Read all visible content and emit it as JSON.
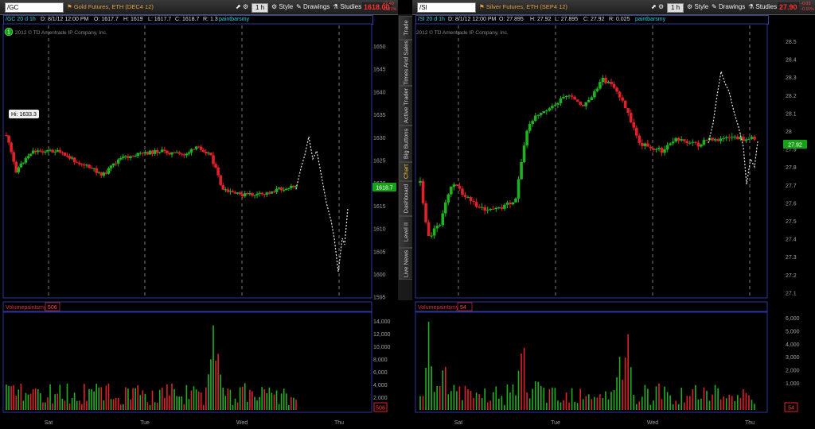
{
  "left": {
    "symbol": "/GC",
    "title": "Gold Futures, ETH (DEC4 12)",
    "timeframe": "1 h",
    "style_label": "Style",
    "drawings_label": "Drawings",
    "studies_label": "Studies",
    "last_price": "1618.00",
    "change_up": "+2.40",
    "change_pct": "-0.21%",
    "info": {
      "symbol": "/GC 20 d 1h",
      "date": "D: 8/1/12 12:00 PM",
      "open": "O: 1617.7",
      "high": "H: 1619",
      "low": "L: 1617.7",
      "close": "C: 1618.7",
      "range": "R: 1.3",
      "study": "paintbarsmy"
    },
    "copyright": "2012 © TD Ameritrade IP Company, Inc.",
    "hi_label": "Hi: 1633.3",
    "price_axis": [
      "1650",
      "1645",
      "1640",
      "1635",
      "1630",
      "1625",
      "1620",
      "1615",
      "1610",
      "1605",
      "1600",
      "1595"
    ],
    "price_tag": "1618.7",
    "volume_title": "Volumepaintsmy",
    "volume_value": "506",
    "volume_axis": [
      "14,000",
      "12,000",
      "10,000",
      "8,000",
      "6,000",
      "4,000",
      "2,000"
    ],
    "volume_tag": "506",
    "day_labels": [
      "Sat",
      "Tue",
      "Wed",
      "Thu"
    ]
  },
  "right": {
    "symbol": "/SI",
    "title": "Silver Futures, ETH (SEP4 12)",
    "timeframe": "1 h",
    "style_label": "Style",
    "drawings_label": "Drawings",
    "studies_label": "Studies",
    "last_price": "27.90",
    "change_up": "-0.03",
    "change_pct": "-0.11%",
    "info": {
      "symbol": "/SI 20 d 1h",
      "date": "D: 8/1/12 12:00 PM",
      "open": "O: 27.895",
      "high": "H: 27.92",
      "low": "L: 27.895",
      "close": "C: 27.92",
      "range": "R: 0.025",
      "study": "paintbarsmy"
    },
    "copyright": "2012 © TD Ameritrade IP Company, Inc.",
    "price_axis": [
      "28.5",
      "28.4",
      "28.3",
      "28.2",
      "28.1",
      "28",
      "27.9",
      "27.8",
      "27.7",
      "27.6",
      "27.5",
      "27.4",
      "27.3",
      "27.2",
      "27.1"
    ],
    "price_tag": "27.92",
    "volume_title": "Volumepaintsmy",
    "volume_value": "54",
    "volume_axis": [
      "6,000",
      "5,000",
      "4,000",
      "3,000",
      "2,000",
      "1,000"
    ],
    "volume_tag": "54",
    "day_labels": [
      "Sat",
      "Tue",
      "Wed",
      "Thu"
    ]
  },
  "sidebar": {
    "tabs": [
      "Trade",
      "Times And Sales",
      "Active Trader",
      "Big Buttons",
      "Chart",
      "Dashboard",
      "Level II",
      "Live News"
    ],
    "active": "Chart"
  },
  "colors": {
    "up": "#1fb21f",
    "down": "#e0202a",
    "grid": "#9a9a9a",
    "axis_text": "#9aa0a8",
    "frame": "#2a3aa0",
    "projection": "#e8e8e8"
  }
}
